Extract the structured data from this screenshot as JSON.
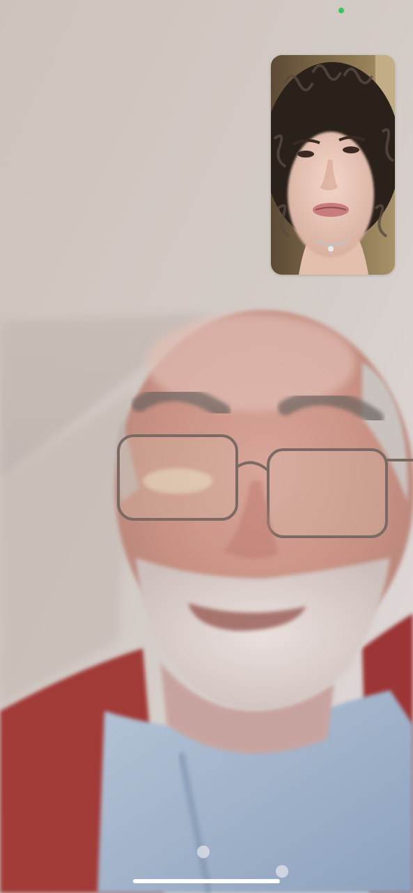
{
  "call": {
    "remote_feed": "remote-participant-video",
    "self_view": "self-preview-video"
  },
  "status": {
    "camera_indicator_color": "#34c759"
  },
  "system": {
    "home_indicator_color": "#ffffff"
  }
}
